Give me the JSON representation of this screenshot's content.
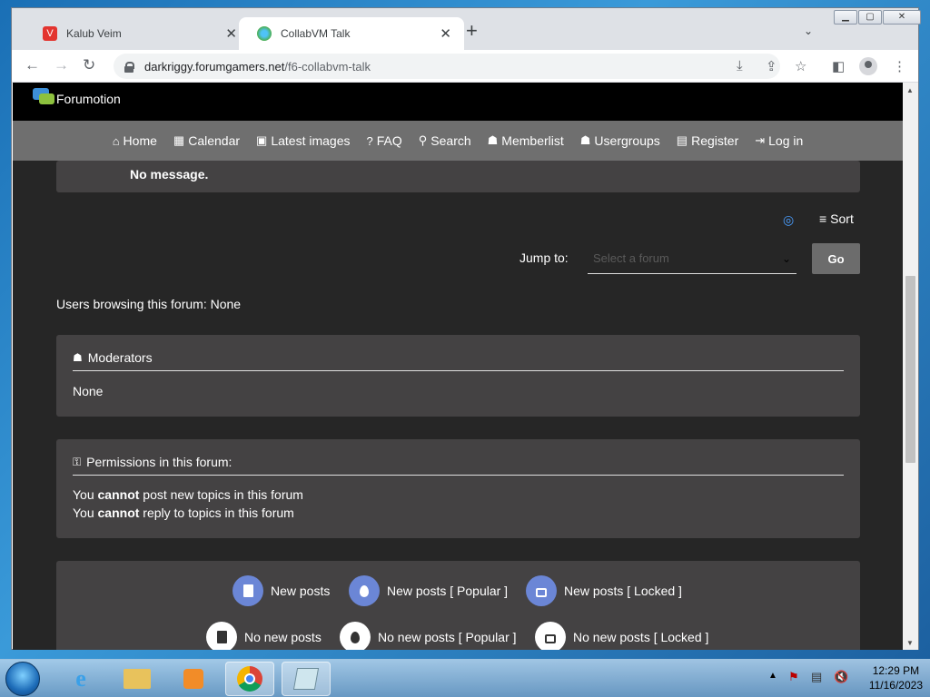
{
  "browser": {
    "tabs": [
      {
        "title": "Kalub Veim",
        "icon": "vivaldi-icon",
        "color": "#e3342f"
      },
      {
        "title": "CollabVM Talk",
        "icon": "globe-icon",
        "color": "#4caf50"
      }
    ],
    "url_domain": "darkriggy.forumgamers.net",
    "url_path": "/f6-collabvm-talk"
  },
  "site": {
    "brand": "Forumotion",
    "nav": [
      {
        "label": "Home",
        "icon": "home-icon"
      },
      {
        "label": "Calendar",
        "icon": "calendar-icon"
      },
      {
        "label": "Latest images",
        "icon": "images-icon"
      },
      {
        "label": "FAQ",
        "icon": "question-icon"
      },
      {
        "label": "Search",
        "icon": "search-icon"
      },
      {
        "label": "Memberlist",
        "icon": "members-icon"
      },
      {
        "label": "Usergroups",
        "icon": "usergroups-icon"
      },
      {
        "label": "Register",
        "icon": "register-icon"
      },
      {
        "label": "Log in",
        "icon": "login-icon"
      }
    ]
  },
  "page": {
    "no_message": "No message.",
    "sort_label": "Sort",
    "jump_label": "Jump to:",
    "jump_placeholder": "Select a forum",
    "go_label": "Go",
    "browsing_text": "Users browsing this forum: None",
    "moderators_title": "Moderators",
    "moderators_value": "None",
    "permissions_title": "Permissions in this forum:",
    "perm1": {
      "pre": "You ",
      "bold": "cannot",
      "post": " post new topics in this forum"
    },
    "perm2": {
      "pre": "You ",
      "bold": "cannot",
      "post": " reply to topics in this forum"
    },
    "legend": {
      "new_posts": "New posts",
      "new_posts_popular": "New posts [ Popular ]",
      "new_posts_locked": "New posts [ Locked ]",
      "no_new_posts": "No new posts",
      "no_new_posts_popular": "No new posts [ Popular ]",
      "no_new_posts_locked": "No new posts [ Locked ]"
    }
  },
  "taskbar": {
    "time": "12:29 PM",
    "date": "11/16/2023"
  }
}
